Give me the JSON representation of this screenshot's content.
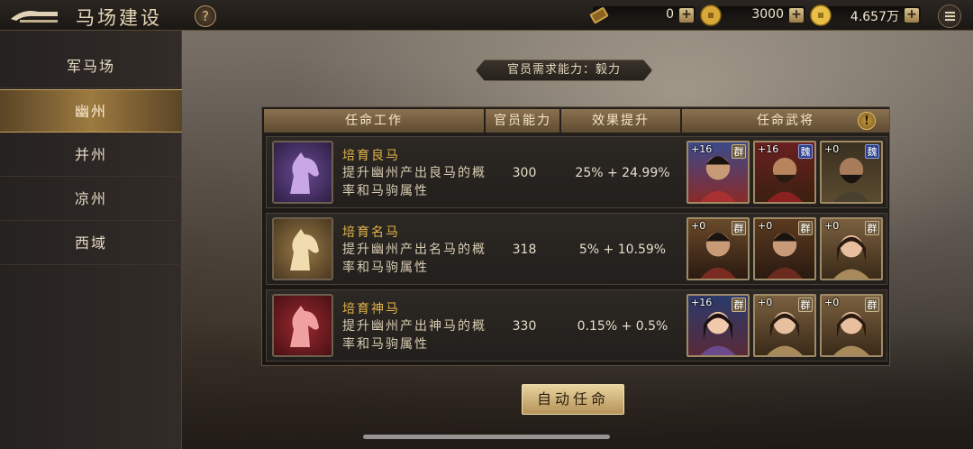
{
  "header": {
    "title": "马场建设",
    "help_label": "?",
    "resources": [
      {
        "icon": "scroll-icon",
        "value": "0",
        "plus": "+"
      },
      {
        "icon": "copper-coin-icon",
        "value": "3000",
        "plus": "+"
      },
      {
        "icon": "gold-coin-icon",
        "value": "4.657万",
        "plus": "+"
      }
    ]
  },
  "sidebar": {
    "items": [
      {
        "label": "军马场",
        "active": false
      },
      {
        "label": "幽州",
        "active": true
      },
      {
        "label": "并州",
        "active": false
      },
      {
        "label": "凉州",
        "active": false
      },
      {
        "label": "西域",
        "active": false
      }
    ]
  },
  "requirement": "官员需求能力：毅力",
  "table": {
    "headers": [
      "任命工作",
      "官员能力",
      "效果提升",
      "任命武将"
    ],
    "info_label": "!",
    "rows": [
      {
        "task": "培育良马",
        "desc": "提升幽州产出良马的概率和马驹属性",
        "ability": "300",
        "effect": "25% + 24.99%",
        "horse_color": "#7a52a8",
        "officers": [
          {
            "bonus": "+16",
            "faction": "群",
            "faction_type": "qun"
          },
          {
            "bonus": "+16",
            "faction": "魏",
            "faction_type": "wei"
          },
          {
            "bonus": "+0",
            "faction": "魏",
            "faction_type": "wei"
          }
        ]
      },
      {
        "task": "培育名马",
        "desc": "提升幽州产出名马的概率和马驹属性",
        "ability": "318",
        "effect": "5% + 10.59%",
        "horse_color": "#b89253",
        "officers": [
          {
            "bonus": "+0",
            "faction": "群",
            "faction_type": "qun"
          },
          {
            "bonus": "+0",
            "faction": "群",
            "faction_type": "qun"
          },
          {
            "bonus": "+0",
            "faction": "群",
            "faction_type": "qun"
          }
        ]
      },
      {
        "task": "培育神马",
        "desc": "提升幽州产出神马的概率和马驹属性",
        "ability": "330",
        "effect": "0.15% + 0.5%",
        "horse_color": "#a8343a",
        "officers": [
          {
            "bonus": "+16",
            "faction": "群",
            "faction_type": "qun"
          },
          {
            "bonus": "+0",
            "faction": "群",
            "faction_type": "qun"
          },
          {
            "bonus": "+0",
            "faction": "群",
            "faction_type": "qun"
          }
        ]
      }
    ]
  },
  "auto_button": "自动任命"
}
